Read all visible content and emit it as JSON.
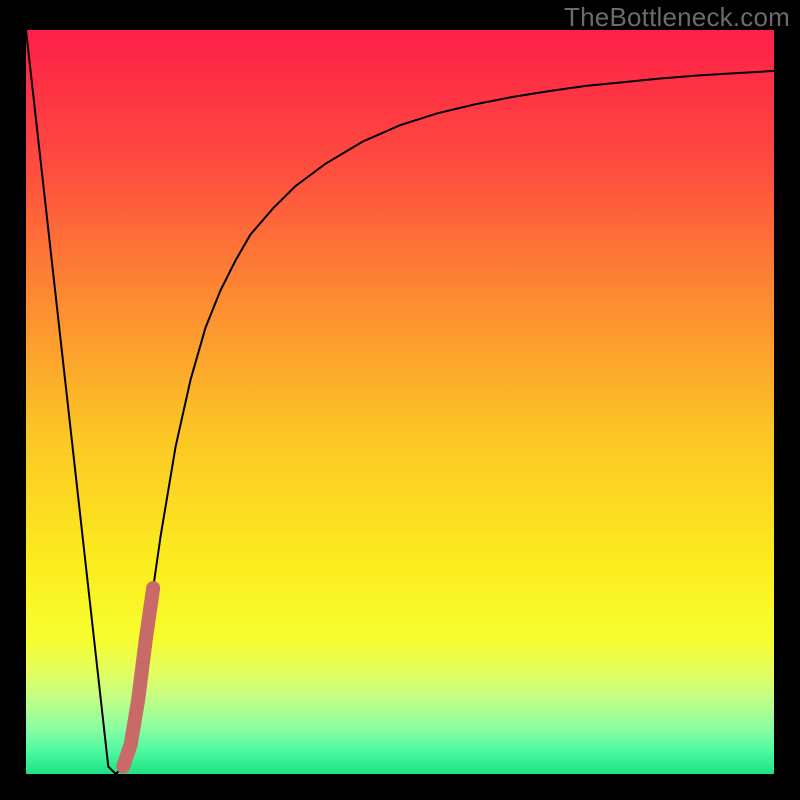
{
  "watermark": "TheBottleneck.com",
  "chart_data": {
    "type": "line",
    "title": "",
    "xlabel": "",
    "ylabel": "",
    "xlim": [
      0,
      100
    ],
    "ylim": [
      0,
      100
    ],
    "grid": false,
    "legend": false,
    "series": [
      {
        "name": "bottleneck-curve",
        "color": "#000000",
        "stroke_width": 2,
        "x": [
          0,
          2,
          4,
          6,
          8,
          10,
          11,
          12,
          13,
          14,
          15,
          16,
          17,
          18,
          20,
          22,
          24,
          26,
          28,
          30,
          33,
          36,
          40,
          45,
          50,
          55,
          60,
          65,
          70,
          75,
          80,
          85,
          90,
          95,
          100
        ],
        "values": [
          100,
          82,
          64,
          46,
          28,
          10,
          1,
          0,
          1,
          4,
          10,
          18,
          25,
          32,
          44,
          53,
          60,
          65,
          69,
          72.5,
          76,
          79,
          82,
          85,
          87.2,
          88.8,
          90,
          91,
          91.8,
          92.5,
          93,
          93.5,
          93.9,
          94.2,
          94.5
        ]
      },
      {
        "name": "highlight-segment",
        "color": "#c76a68",
        "stroke_width": 14,
        "linecap": "round",
        "x": [
          13.0,
          14.0,
          15.0,
          16.0,
          17.0
        ],
        "values": [
          1.0,
          4.0,
          10.0,
          18.0,
          25.0
        ]
      }
    ],
    "background_gradient": {
      "type": "vertical",
      "stops": [
        {
          "pos": 0.0,
          "color": "#fe1f48"
        },
        {
          "pos": 0.18,
          "color": "#fe4b3f"
        },
        {
          "pos": 0.36,
          "color": "#fd8a32"
        },
        {
          "pos": 0.55,
          "color": "#fcc825"
        },
        {
          "pos": 0.72,
          "color": "#fbed1e"
        },
        {
          "pos": 0.82,
          "color": "#f7fe30"
        },
        {
          "pos": 0.86,
          "color": "#e4fe5c"
        },
        {
          "pos": 0.9,
          "color": "#c0fe86"
        },
        {
          "pos": 0.94,
          "color": "#88fea2"
        },
        {
          "pos": 0.97,
          "color": "#4cf8a0"
        },
        {
          "pos": 1.0,
          "color": "#1de184"
        }
      ]
    }
  }
}
